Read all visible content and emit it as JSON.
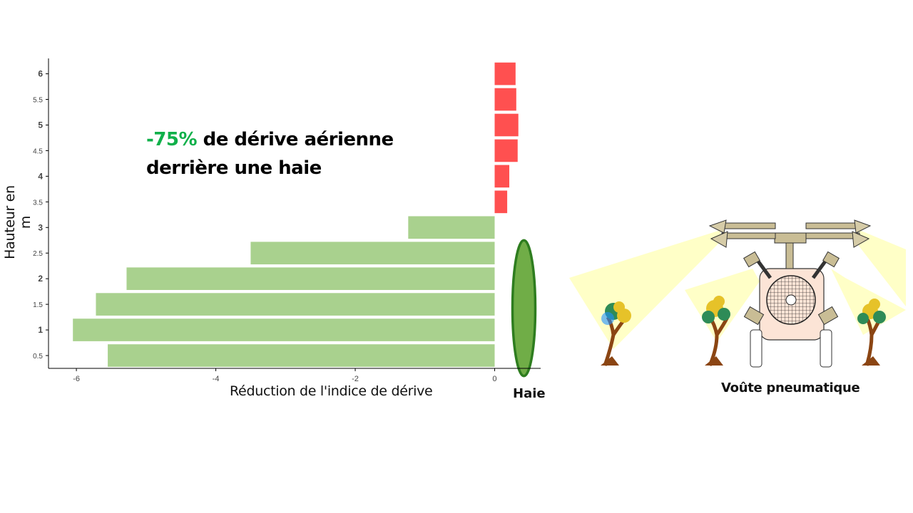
{
  "headline": {
    "highlight": "-75%",
    "rest_line1": " de dérive aérienne",
    "line2": "derrière une haie"
  },
  "labels": {
    "hedge": "Haie",
    "sprayer": "Voûte pneumatique"
  },
  "colors": {
    "reduction_bar": "#a9d18e",
    "above_hedge_bar": "#ff5050",
    "hedge": "#70ad47",
    "hedge_edge": "#2e7d1f",
    "highlight": "#10b04a"
  },
  "chart_data": {
    "type": "bar",
    "orientation": "horizontal",
    "xlabel": "Réduction de l'indice de dérive",
    "ylabel": "Hauteur en m",
    "xlim": [
      -6.4,
      0.66
    ],
    "ylim": [
      0.25,
      6.3
    ],
    "x_ticks": [
      -6,
      -4,
      -2,
      0
    ],
    "y_ticks": [
      0.5,
      1,
      1.5,
      2,
      2.5,
      3,
      3.5,
      4,
      4.5,
      5,
      5.5,
      6
    ],
    "y_tick_labels": [
      "0.5",
      "1",
      "1.5",
      "2",
      "2.5",
      "3",
      "3.5",
      "4",
      "4.5",
      "5",
      "5.5",
      "6"
    ],
    "y_bold_ticks": [
      1,
      2,
      3,
      4,
      5,
      6
    ],
    "series": [
      {
        "heights": [
          0.5,
          1,
          1.5,
          2,
          2.5,
          3,
          3.5,
          4,
          4.5,
          5,
          5.5,
          6
        ],
        "values": [
          -5.55,
          -6.05,
          -5.72,
          -5.28,
          -3.5,
          -1.24,
          0.18,
          0.21,
          0.33,
          0.34,
          0.31,
          0.3
        ]
      }
    ],
    "hedge_height": [
      0.1,
      2.75
    ],
    "grid": false,
    "legend": "none"
  }
}
